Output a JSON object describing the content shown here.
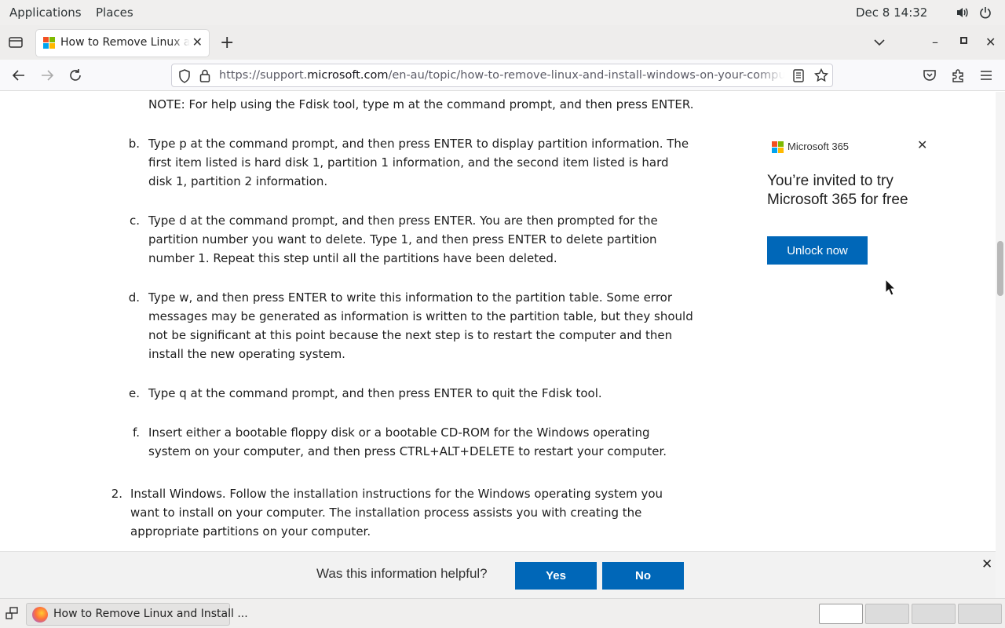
{
  "topbar": {
    "applications": "Applications",
    "places": "Places",
    "clock": "Dec 8  14:32"
  },
  "browser": {
    "tab_title": "How to Remove Linux and Install Windows on Your Computer",
    "url_prefix": "https://support.",
    "url_domain": "microsoft.com",
    "url_suffix": "/en-au/topic/how-to-remove-linux-and-install-windows-on-your-computer"
  },
  "article": {
    "note": "NOTE: For help using the Fdisk tool, type m at the command prompt, and then press ENTER.",
    "steps": [
      {
        "marker": "b.",
        "text": "Type p at the command prompt, and then press ENTER to display partition information. The first item listed is hard disk 1, partition 1 information, and the second item listed is hard disk 1, partition 2 information."
      },
      {
        "marker": "c.",
        "text": "Type d at the command prompt, and then press ENTER. You are then prompted for the partition number you want to delete. Type 1, and then press ENTER to delete partition number 1. Repeat this step until all the partitions have been deleted."
      },
      {
        "marker": "d.",
        "text": "Type w, and then press ENTER to write this information to the partition table. Some error messages may be generated as information is written to the partition table, but they should not be significant at this point because the next step is to restart the computer and then install the new operating system."
      },
      {
        "marker": "e.",
        "text": "Type q at the command prompt, and then press ENTER to quit the Fdisk tool."
      },
      {
        "marker": "f.",
        "text": "Insert either a bootable floppy disk or a bootable CD-ROM for the Windows operating system on your computer, and then press CTRL+ALT+DELETE to restart your computer."
      }
    ],
    "item2_marker": "2.",
    "item2_text": "Install Windows. Follow the installation instructions for the Windows operating system you want to install on your computer. The installation process assists you with creating the appropriate partitions on your computer."
  },
  "ad": {
    "brand": "Microsoft 365",
    "headline": "You’re invited to try Microsoft 365 for free",
    "cta": "Unlock now"
  },
  "feedback": {
    "question": "Was this information helpful?",
    "yes": "Yes",
    "no": "No"
  },
  "taskbar": {
    "task_label": "How to Remove Linux and Install ..."
  },
  "colors": {
    "ms_blue": "#0067b8"
  }
}
